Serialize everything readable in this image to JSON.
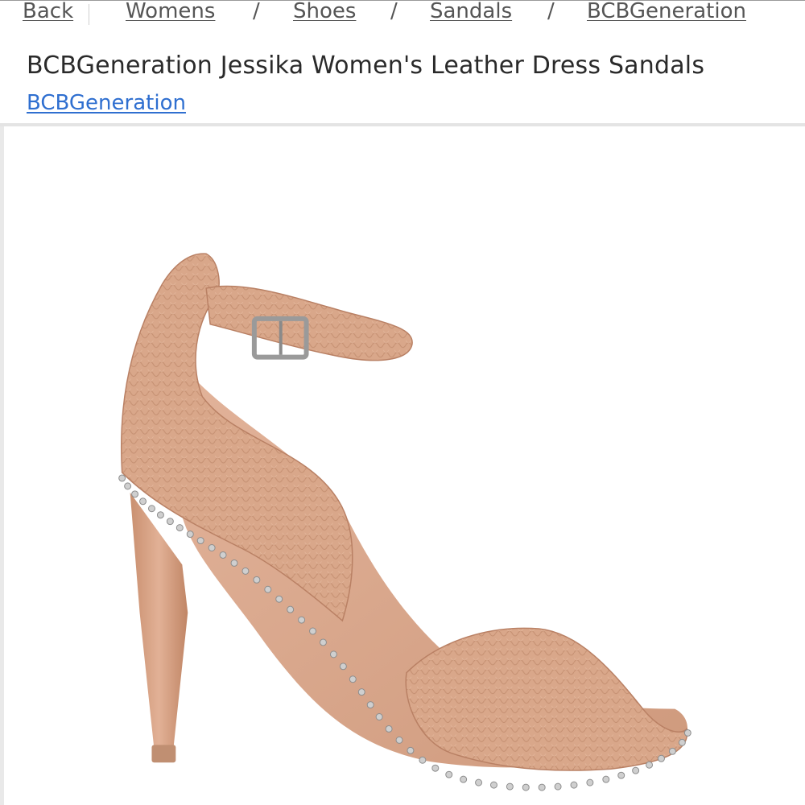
{
  "breadcrumb": {
    "back_label": "Back",
    "items": [
      {
        "label": "Womens"
      },
      {
        "label": "Shoes"
      },
      {
        "label": "Sandals"
      },
      {
        "label": "BCBGeneration"
      }
    ],
    "separator": "/"
  },
  "product": {
    "title": "BCBGeneration Jessika Women's Leather Dress Sandals",
    "brand_link": "BCBGeneration",
    "image_alt": "BCBGeneration Jessika sandal"
  },
  "colors": {
    "link": "#2f6fd0",
    "breadcrumb_text": "#555555",
    "shoe_leather": "#d9a78a",
    "studs": "#c8c8c8"
  }
}
